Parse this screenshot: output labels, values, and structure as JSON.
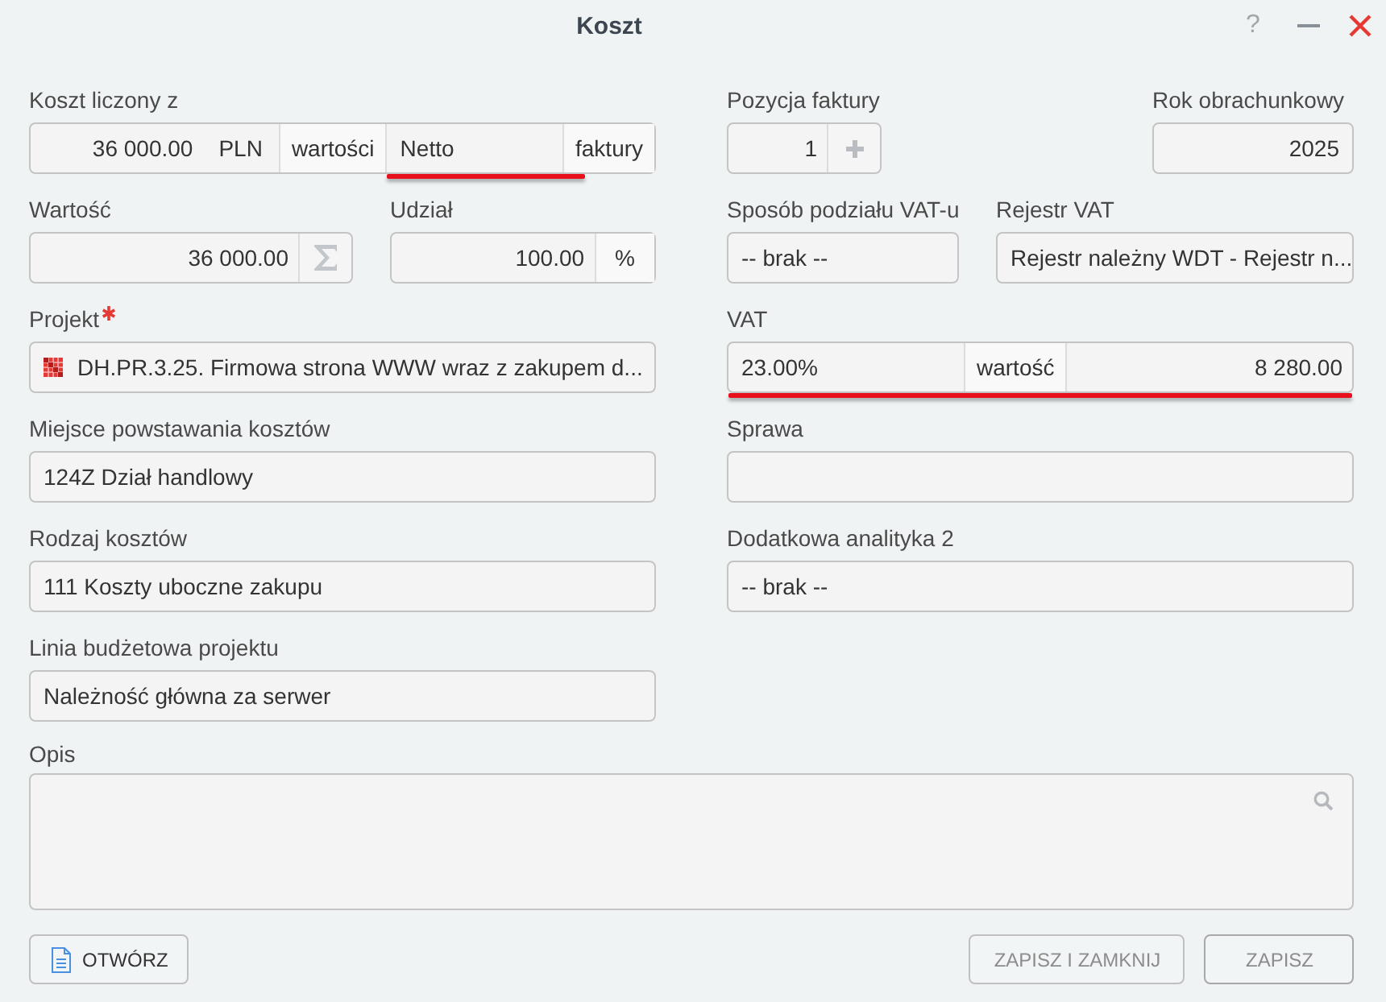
{
  "window": {
    "title": "Koszt",
    "help": "?"
  },
  "rows": [
    {
      "left": [
        {
          "label": "Koszt liczony z",
          "required": false,
          "underlined": false,
          "segments": [
            {
              "kind": "number",
              "text": "36 000.00",
              "underlined": false
            },
            {
              "kind": "unit",
              "text": "PLN",
              "underlined": false
            },
            {
              "kind": "addon",
              "text": "wartości",
              "underlined": false
            },
            {
              "kind": "text",
              "text": "Netto",
              "underlined": true
            },
            {
              "kind": "addon",
              "text": "faktury",
              "underlined": false
            }
          ]
        }
      ],
      "right": [
        {
          "label": "Pozycja faktury",
          "required": false,
          "underlined": false,
          "segments": [
            {
              "kind": "number",
              "text": "1",
              "underlined": false
            },
            {
              "kind": "add",
              "underlined": false
            }
          ]
        },
        {
          "label": "Rok obrachunkowy",
          "required": false,
          "underlined": false,
          "segments": [
            {
              "kind": "number",
              "text": "2025",
              "underlined": false
            }
          ]
        }
      ]
    },
    {
      "left": [
        {
          "label": "Wartość",
          "required": false,
          "underlined": false,
          "segments": [
            {
              "kind": "number",
              "text": "36 000.00",
              "underlined": false
            },
            {
              "kind": "sum",
              "underlined": false
            }
          ]
        },
        {
          "label": "Udział",
          "required": false,
          "underlined": false,
          "segments": [
            {
              "kind": "number",
              "text": "100.00",
              "underlined": false
            },
            {
              "kind": "addon",
              "text": "%",
              "underlined": false
            }
          ]
        }
      ],
      "right": [
        {
          "label": "Sposób podziału VAT-u",
          "required": false,
          "underlined": false,
          "segments": [
            {
              "kind": "text",
              "text": "-- brak --",
              "underlined": false
            }
          ]
        },
        {
          "label": "Rejestr VAT",
          "required": false,
          "underlined": false,
          "segments": [
            {
              "kind": "text",
              "text": "Rejestr należny WDT - Rejestr n...",
              "underlined": false
            }
          ]
        }
      ]
    },
    {
      "left": [
        {
          "label": "Projekt",
          "required": true,
          "underlined": false,
          "segments": [
            {
              "kind": "project",
              "underlined": false
            },
            {
              "kind": "text",
              "text": "DH.PR.3.25. Firmowa strona WWW wraz z zakupem d...",
              "underlined": false
            }
          ]
        }
      ],
      "right": [
        {
          "label": "VAT",
          "required": false,
          "underlined": true,
          "segments": [
            {
              "kind": "text",
              "text": "23.00%",
              "underlined": false
            },
            {
              "kind": "addon",
              "text": "wartość",
              "underlined": false
            },
            {
              "kind": "number",
              "text": "8 280.00",
              "underlined": false
            }
          ]
        }
      ]
    },
    {
      "left": [
        {
          "label": "Miejsce powstawania kosztów",
          "required": false,
          "underlined": false,
          "segments": [
            {
              "kind": "text",
              "text": "124Z Dział handlowy",
              "underlined": false
            }
          ]
        }
      ],
      "right": [
        {
          "label": "Sprawa",
          "required": false,
          "underlined": false,
          "segments": [
            {
              "kind": "text",
              "underlined": false
            }
          ]
        }
      ]
    },
    {
      "left": [
        {
          "label": "Rodzaj kosztów",
          "required": false,
          "underlined": false,
          "segments": [
            {
              "kind": "text",
              "text": "111 Koszty uboczne zakupu",
              "underlined": false
            }
          ]
        }
      ],
      "right": [
        {
          "label": "Dodatkowa analityka 2",
          "required": false,
          "underlined": false,
          "segments": [
            {
              "kind": "text",
              "text": "-- brak --",
              "underlined": false
            }
          ]
        }
      ]
    },
    {
      "left": [
        {
          "label": "Linia budżetowa projektu",
          "required": false,
          "underlined": false,
          "segments": [
            {
              "kind": "text",
              "text": "Należność główna za serwer",
              "underlined": false
            }
          ]
        }
      ]
    }
  ],
  "description": {
    "label": "Opis"
  },
  "footer": {
    "left": [
      {
        "label": "OTWÓRZ",
        "disabled": false
      }
    ],
    "right": [
      {
        "label": "ZAPISZ I ZAMKNIJ",
        "disabled": true
      },
      {
        "label": "ZAPISZ",
        "disabled": true
      }
    ]
  }
}
